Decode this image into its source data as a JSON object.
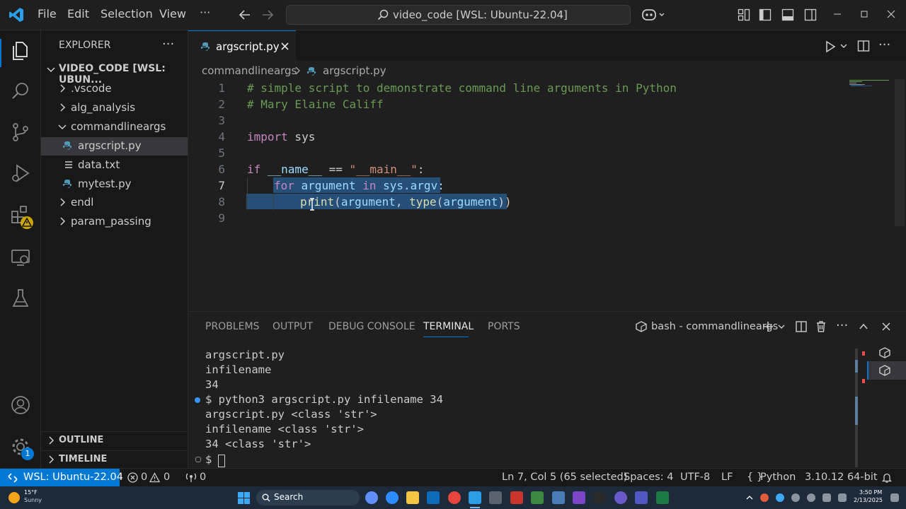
{
  "titlebar": {
    "menu": [
      "File",
      "Edit",
      "Selection",
      "View"
    ],
    "more": "···",
    "command_center": "video_code [WSL: Ubuntu-22.04]"
  },
  "sidebar": {
    "title": "EXPLORER",
    "more": "···",
    "root": "VIDEO_CODE [WSL: UBUN...",
    "items": [
      {
        "label": ".vscode",
        "kind": "folder-collapsed"
      },
      {
        "label": "alg_analysis",
        "kind": "folder-collapsed"
      },
      {
        "label": "commandlineargs",
        "kind": "folder-expanded"
      },
      {
        "label": "argscript.py",
        "kind": "python-file"
      },
      {
        "label": "data.txt",
        "kind": "text-file"
      },
      {
        "label": "mytest.py",
        "kind": "python-file"
      },
      {
        "label": "endl",
        "kind": "folder-collapsed"
      },
      {
        "label": "param_passing",
        "kind": "folder-collapsed"
      }
    ],
    "outline": "OUTLINE",
    "timeline": "TIMELINE"
  },
  "editor": {
    "tab_label": "argscript.py",
    "breadcrumb": [
      "commandlineargs",
      "argscript.py"
    ],
    "line_numbers": [
      "1",
      "2",
      "3",
      "4",
      "5",
      "6",
      "7",
      "8",
      "9"
    ],
    "lines": {
      "l1": "# simple script to demonstrate command line arguments in Python",
      "l2": "# Mary Elaine Califf",
      "l4_kw": "import",
      "l4_rest": " sys",
      "l6_kw": "if",
      "l6_var": " __name__",
      "l6_op": " == ",
      "l6_str": "\"__main__\"",
      "l6_colon": ":",
      "l7_for": "for",
      "l7_var": " argument ",
      "l7_in": "in",
      "l7_rest": " sys.argv:",
      "l8_fn": "print",
      "l8_open": "(",
      "l8_arg": "argument",
      "l8_comma": ", ",
      "l8_type": "type",
      "l8_open2": "(",
      "l8_arg2": "argument",
      "l8_close": "))"
    }
  },
  "panel": {
    "tabs": [
      "PROBLEMS",
      "OUTPUT",
      "DEBUG CONSOLE",
      "TERMINAL",
      "PORTS"
    ],
    "active_tab": "TERMINAL",
    "terminal_name": "bash - commandlineargs",
    "terminal_lines": [
      "argscript.py",
      "infilename",
      "34",
      "$ python3 argscript.py infilename 34",
      "argscript.py <class 'str'>",
      "infilename <class 'str'>",
      "34 <class 'str'>",
      "$ "
    ]
  },
  "statusbar": {
    "remote": "WSL: Ubuntu-22.04",
    "errors": "0",
    "warnings": "0",
    "ports": "0",
    "cursor": "Ln 7, Col 5 (65 selected)",
    "spaces": "Spaces: 4",
    "encoding": "UTF-8",
    "eol": "LF",
    "language": "Python",
    "interpreter": "3.10.12 64-bit"
  },
  "taskbar": {
    "weather_temp": "15°F",
    "weather_desc": "Sunny",
    "search": "Search",
    "time": "3:50 PM",
    "date": "2/13/2025"
  },
  "badges": {
    "settings": "1"
  },
  "colors": {
    "accent": "#0078d4",
    "selection": "#264f78",
    "background": "#1f1f1f"
  }
}
